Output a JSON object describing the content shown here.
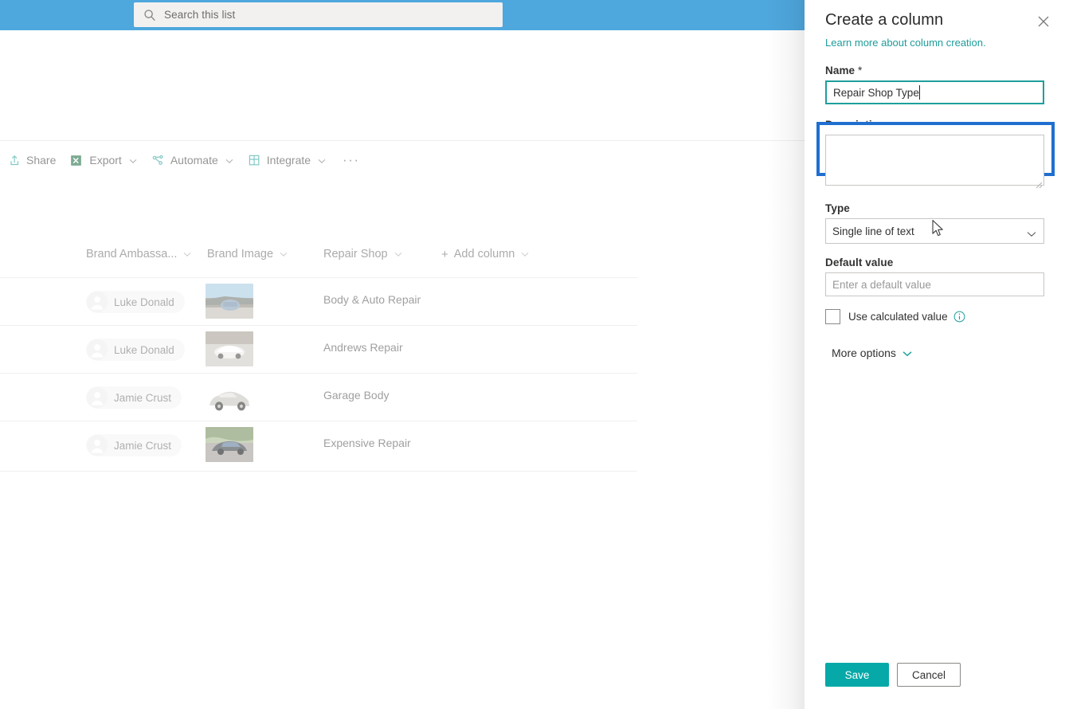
{
  "topbar": {
    "search": {
      "placeholder": "Search this list",
      "value": "",
      "icon": "search-icon"
    },
    "bg_color": "#4ea7dd"
  },
  "commandbar": {
    "items": [
      {
        "label": "Share",
        "icon": "share-icon",
        "has_chevron": false
      },
      {
        "label": "Export",
        "icon": "excel-export-icon",
        "has_chevron": true
      },
      {
        "label": "Automate",
        "icon": "automate-flow-icon",
        "has_chevron": true
      },
      {
        "label": "Integrate",
        "icon": "integrate-grid-icon",
        "has_chevron": true
      }
    ],
    "overflow_label": "···"
  },
  "list": {
    "columns": [
      {
        "label": "Brand Ambassa...",
        "has_chevron": true
      },
      {
        "label": "Brand Image",
        "has_chevron": true
      },
      {
        "label": "Repair Shop",
        "has_chevron": true
      },
      {
        "label": "Add column",
        "has_chevron": true,
        "prefix": "+"
      }
    ],
    "rows": [
      {
        "ambassador": "Luke Donald",
        "image": "blue-car-on-road-thumbnail",
        "repair_shop": "Body & Auto Repair"
      },
      {
        "ambassador": "Luke Donald",
        "image": "white-car-thumbnail",
        "repair_shop": "Andrews Repair"
      },
      {
        "ambassador": "Jamie Crust",
        "image": "silver-sedan-thumbnail",
        "repair_shop": "Garage Body"
      },
      {
        "ambassador": "Jamie Crust",
        "image": "dark-car-outdoors-thumbnail",
        "repair_shop": "Expensive Repair"
      }
    ]
  },
  "panel": {
    "title": "Create a column",
    "close_label": "✕",
    "learn_more": "Learn more about column creation.",
    "learn_more_color": "#1e9c9a",
    "highlight_color": "#1f6fd0",
    "name": {
      "label": "Name",
      "required_marker": " *",
      "value": "Repair Shop Type",
      "focus_border_color": "#1f9e9c"
    },
    "description": {
      "label": "Description",
      "value": "",
      "placeholder": ""
    },
    "type": {
      "label": "Type",
      "selected": "Single line of text",
      "chevron_icon": "chevron-down-icon"
    },
    "default_value": {
      "label": "Default value",
      "value": "",
      "placeholder": "Enter a default value"
    },
    "calculated": {
      "label": "Use calculated value",
      "checked": false,
      "info_icon": "info-icon"
    },
    "more_options": {
      "label": "More options",
      "chevron_icon": "chevron-down-icon"
    },
    "footer": {
      "save_label": "Save",
      "cancel_label": "Cancel",
      "save_color": "#06a8a8"
    }
  }
}
